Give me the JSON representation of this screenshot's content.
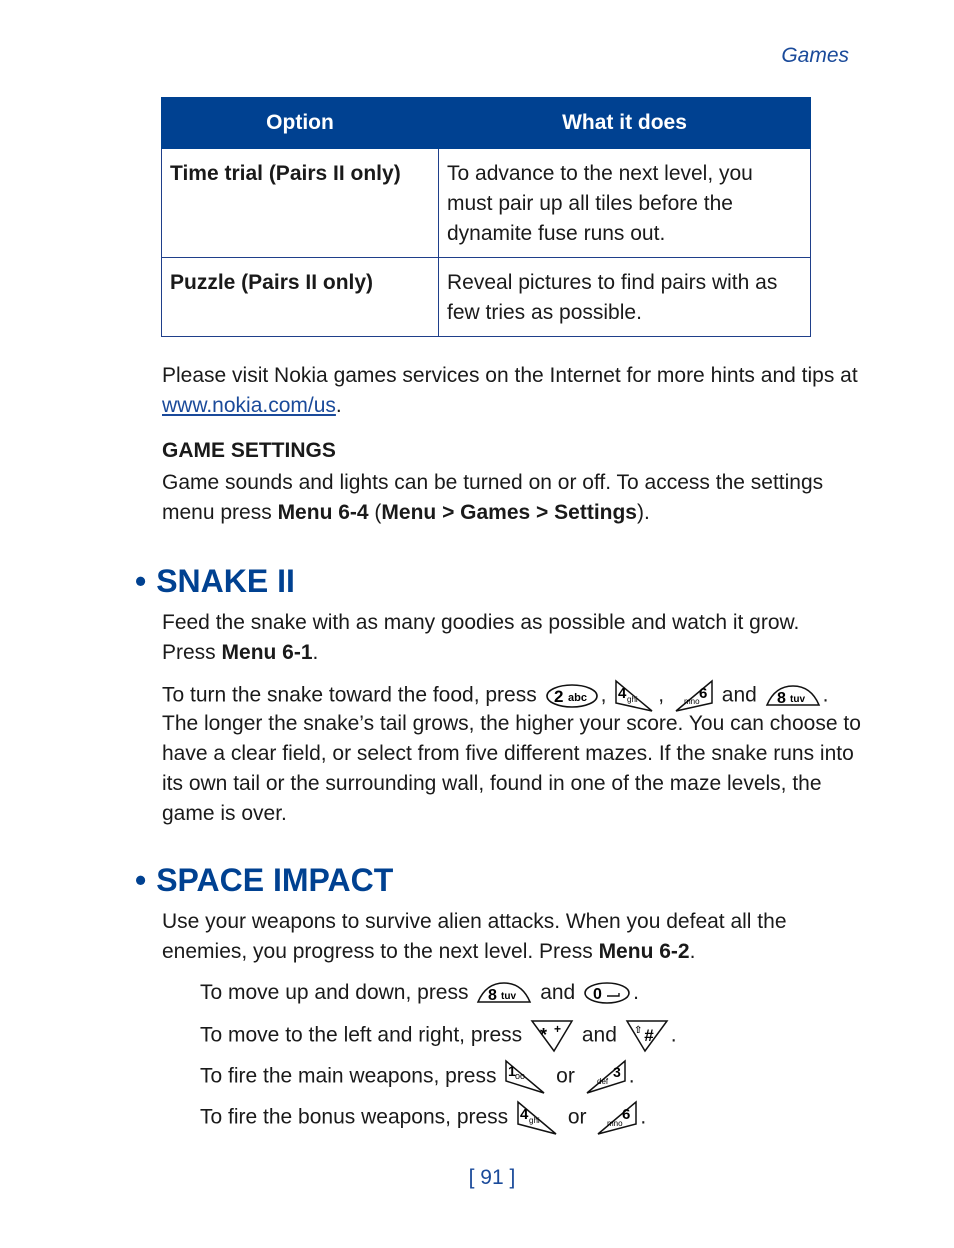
{
  "running_head": "Games",
  "table": {
    "headers": [
      "Option",
      "What it does"
    ],
    "rows": [
      {
        "option": "Time trial (Pairs II only)",
        "description": "To advance to the next level, you must pair up all tiles before the dynamite fuse runs out."
      },
      {
        "option": "Puzzle (Pairs II only)",
        "description": "Reveal pictures to find pairs with as few tries as possible."
      }
    ]
  },
  "visit_text": {
    "before": "Please visit Nokia games services on the Internet for more hints and tips at ",
    "link": "www.nokia.com/us",
    "after": "."
  },
  "game_settings": {
    "heading": "GAME SETTINGS",
    "text_before": "Game sounds and lights can be turned on or off. To access the settings menu press ",
    "menu_code": "Menu 6-4",
    "paren_open": " (",
    "menu_path": "Menu > Games > Settings",
    "paren_close": ")."
  },
  "snake": {
    "title": "SNAKE II",
    "bullet": "•",
    "intro": "Feed the snake with as many goodies as possible and watch it grow.",
    "press": "Press ",
    "menu_code": "Menu 6-1",
    "period": ".",
    "turn_text": "To turn the snake toward the food, press",
    "comma": ",",
    "and": "and",
    "body": "The longer the snake’s tail grows, the higher your score. You can choose to have a clear field, or select from five different mazes. If the snake runs into its own tail or the surrounding wall, found in one of the maze levels, the game is over.",
    "keys": [
      {
        "digit": "2",
        "letters": "abc"
      },
      {
        "digit": "4",
        "letters": "ghi"
      },
      {
        "digit": "6",
        "letters": "mno"
      },
      {
        "digit": "8",
        "letters": "tuv"
      }
    ]
  },
  "space_impact": {
    "title": "SPACE IMPACT",
    "bullet": "•",
    "intro": "Use your weapons to survive alien attacks. When you defeat all the enemies, you progress to the next level. Press ",
    "menu_code": "Menu 6-2",
    "period": ".",
    "instructions": [
      {
        "text": "To move up and down, press",
        "joiner": "and",
        "keys": [
          {
            "digit": "8",
            "letters": "tuv"
          },
          {
            "digit": "0",
            "letters": "␣"
          }
        ]
      },
      {
        "text": "To move to the left and right, press",
        "joiner": "and",
        "keys": [
          {
            "digit": "*",
            "letters": "+"
          },
          {
            "digit": "#",
            "letters": "⇧"
          }
        ]
      },
      {
        "text": "To fire the main weapons, press",
        "joiner": "or",
        "keys": [
          {
            "digit": "1",
            "letters": "oo"
          },
          {
            "digit": "3",
            "letters": "def"
          }
        ]
      },
      {
        "text": "To fire the bonus weapons, press",
        "joiner": "or",
        "keys": [
          {
            "digit": "4",
            "letters": "ghi"
          },
          {
            "digit": "6",
            "letters": "mno"
          }
        ]
      }
    ]
  },
  "page_number": "[ 91 ]",
  "colors": {
    "accent": "#004191",
    "link": "#1a4a9a",
    "text": "#1a1a1a"
  }
}
